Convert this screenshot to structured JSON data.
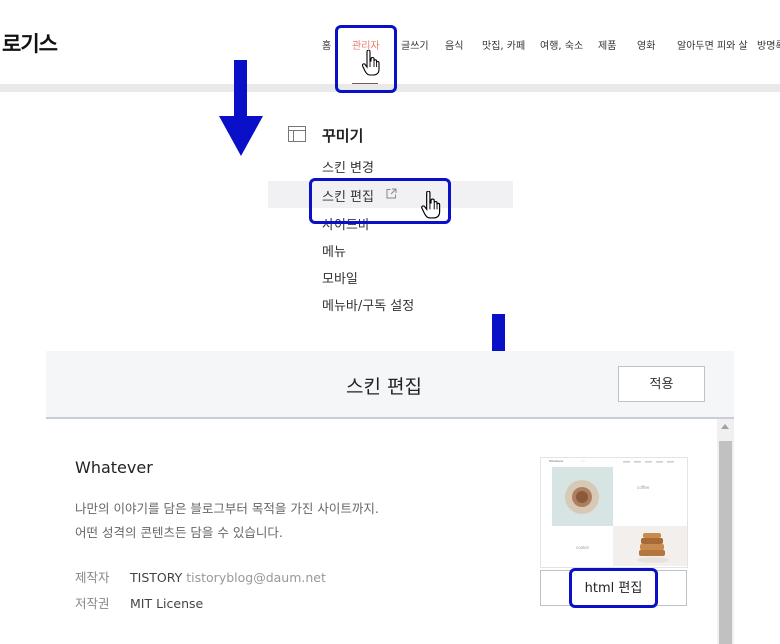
{
  "blog": {
    "logo": "로기스",
    "nav": [
      "홈",
      "관리자",
      "글쓰기",
      "음식",
      "맛집, 카페",
      "여행, 숙소",
      "제품",
      "영화",
      "알아두면 피와 살",
      "방명록"
    ]
  },
  "menu": {
    "header": "꾸미기",
    "items": [
      "스킨 변경",
      "스킨 편집",
      "사이드바",
      "메뉴",
      "모바일",
      "메뉴바/구독 설정"
    ],
    "selected_index": 1
  },
  "skin_edit": {
    "title": "스킨 편집",
    "apply_label": "적용",
    "skin_name": "Whatever",
    "description": [
      "나만의 이야기를 담은 블로그부터 목적을 가진 사이트까지.",
      "어떤 성격의 콘텐츠든 담을 수 있습니다."
    ],
    "maker_label": "제작자",
    "maker_name": "TISTORY",
    "maker_email": "tistoryblog@daum.net",
    "license_label": "저작권",
    "license_value": "MIT License",
    "html_edit_label": "html 편집",
    "thumbnail": {
      "brand": "Whatever",
      "coffee": "coffee",
      "cookie": "cookie"
    }
  },
  "colors": {
    "highlight": "#0a10c8",
    "arrow": "#0a10c8",
    "active_nav": "#f07a6a"
  }
}
